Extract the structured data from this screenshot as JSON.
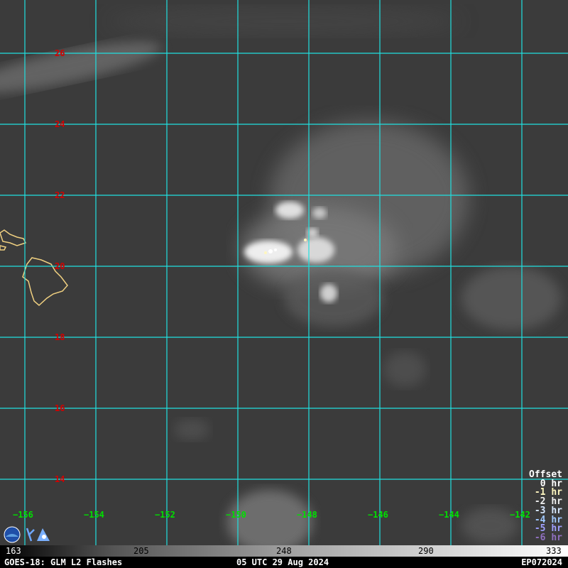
{
  "map": {
    "lat_labels": [
      "26",
      "24",
      "22",
      "20",
      "18",
      "16",
      "14"
    ],
    "lon_labels": [
      "−156",
      "−154",
      "−152",
      "−150",
      "−148",
      "−146",
      "−144",
      "−142"
    ],
    "grid_color": "#20e0e0",
    "coast_color": "#f0d080"
  },
  "offset_legend": {
    "title": "Offset",
    "items": [
      {
        "label": "0 hr",
        "color": "#ffffff"
      },
      {
        "label": "-1 hr",
        "color": "#fff7c0"
      },
      {
        "label": "-2 hr",
        "color": "#f0f0f0"
      },
      {
        "label": "-3 hr",
        "color": "#d8e8ff"
      },
      {
        "label": "-4 hr",
        "color": "#a0c8ff"
      },
      {
        "label": "-5 hr",
        "color": "#a0a0ff"
      },
      {
        "label": "-6 hr",
        "color": "#9070c0"
      }
    ]
  },
  "colorbar": {
    "ticks": [
      "163",
      "205",
      "248",
      "290",
      "333"
    ]
  },
  "footer": {
    "left": "GOES-18: GLM L2 Flashes",
    "center": "05 UTC 29 Aug 2024",
    "right": "EP072024"
  }
}
